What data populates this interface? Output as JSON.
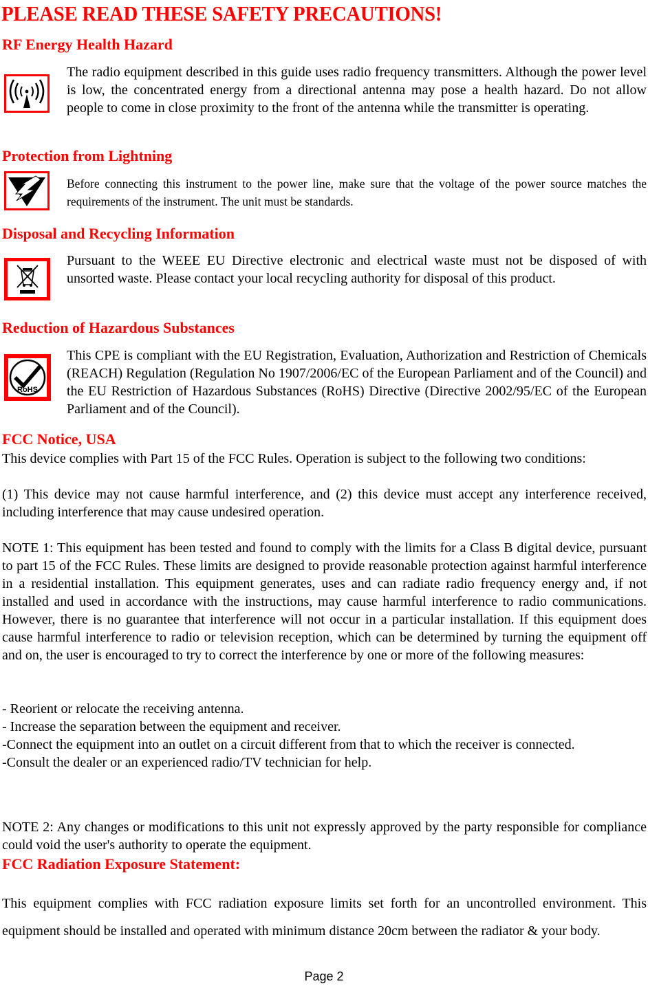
{
  "document": {
    "title": "PLEASE READ THESE SAFETY PRECAUTIONS!",
    "accent_color": "#ff0000",
    "sections": {
      "rf": {
        "heading": "RF Energy Health Hazard",
        "icon": "rf-radiation-icon",
        "text": "The radio equipment described in this guide uses radio frequency transmitters. Although the power level is low, the concentrated energy from a directional antenna may pose a health hazard. Do not allow people to come in close proximity to the front of the antenna while the transmitter is operating."
      },
      "lightning": {
        "heading": "Protection from Lightning",
        "icon": "lightning-warning-icon",
        "text": "Before connecting this instrument to the power line, make sure that the voltage of the power source matches the requirements of the instrument. The unit must be standards."
      },
      "disposal": {
        "heading": "Disposal and Recycling Information",
        "icon": "weee-crossed-bin-icon",
        "text": "Pursuant to the WEEE EU Directive electronic and electrical waste must not be disposed of with unsorted waste. Please contact your local recycling authority for disposal of this product."
      },
      "rohs": {
        "heading": "Reduction of Hazardous Substances",
        "icon": "rohs-check-icon",
        "icon_label": "RoHS",
        "text": "This CPE is compliant with the EU Registration, Evaluation, Authorization and Restriction of Chemicals (REACH) Regulation (Regulation No 1907/2006/EC of the European Parliament and of the Council) and the EU Restriction of Hazardous Substances (RoHS) Directive (Directive 2002/95/EC of the European Parliament and of the Council)."
      },
      "fcc": {
        "heading": "FCC Notice, USA",
        "intro": "This device complies with Part 15 of the FCC Rules. Operation is subject to the following two conditions:",
        "conditions": "(1) This device may not cause harmful interference, and (2) this device must accept any interference received, including interference that may cause undesired operation.",
        "note1": "NOTE 1: This equipment has been tested and found to comply with the limits for a Class B digital device, pursuant to part 15 of the FCC Rules. These limits are designed to provide reasonable protection against harmful interference in a residential installation. This equipment generates, uses and can radiate radio frequency energy and, if not installed and used in accordance with the instructions, may cause harmful interference to radio communications. However, there is no guarantee that interference will not occur in a particular installation. If this equipment does cause harmful interference to radio or television reception, which can be determined by turning the equipment off and on, the user is encouraged to try to correct the interference by one or more of the following measures:",
        "measures": [
          "- Reorient or relocate the receiving antenna.",
          "- Increase the separation between the equipment and receiver.",
          "-Connect the equipment into an outlet on a circuit different from that to which the receiver is connected.",
          "-Consult the dealer or an experienced radio/TV technician for help."
        ],
        "note2": "NOTE 2: Any changes or modifications to this unit not expressly approved by the party responsible for compliance could void the user's authority to operate the equipment."
      },
      "radiation": {
        "heading": "FCC Radiation Exposure Statement:",
        "text": "This equipment complies with FCC radiation exposure limits set forth for an uncontrolled environment. This equipment should be installed and operated with minimum distance 20cm between the radiator & your body."
      }
    },
    "footer": {
      "page_label": "Page 2"
    }
  }
}
